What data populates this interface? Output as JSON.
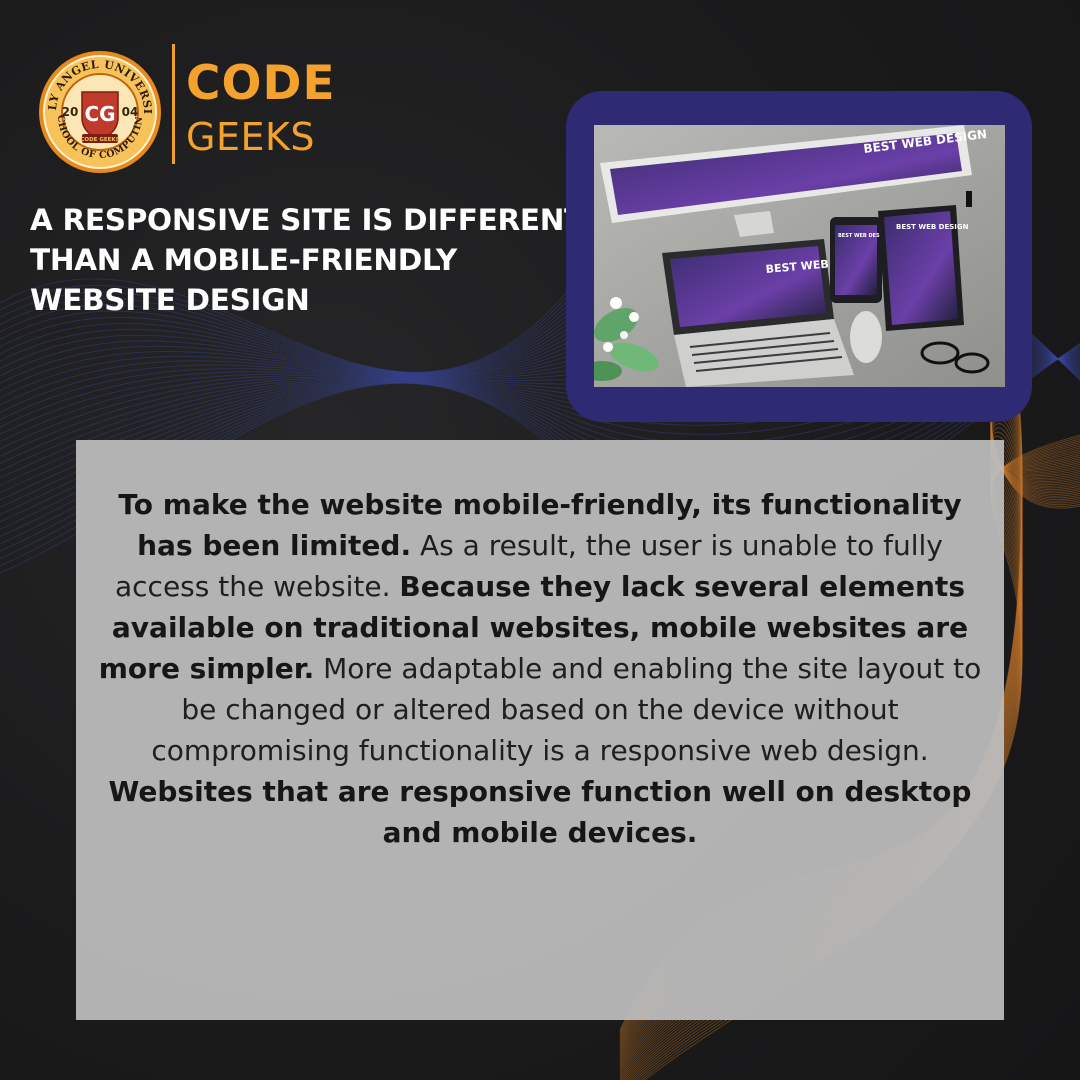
{
  "brand": {
    "seal_top_text": "HOLY ANGEL UNIVERSITY",
    "seal_bottom_text": "SCHOOL OF COMPUTING",
    "seal_year_left": "20",
    "seal_year_right": "04",
    "seal_monogram": "CG",
    "seal_ribbon": "CODE GEEKS",
    "name_line1": "CODE",
    "name_line2": "GEEKS"
  },
  "headline": "A RESPONSIVE SITE IS DIFFERENT THAN A MOBILE-FRIENDLY WEBSITE DESIGN",
  "photo": {
    "monitor_text": "BEST WEB DESIGN",
    "laptop_text": "BEST WEB DESIGN",
    "tablet_text": "BEST WEB DESIGN",
    "phone_text": "BEST WEB DESIGN"
  },
  "body": {
    "p1": "To make the website mobile-friendly, its functionality has been limited.",
    "p2": " As a result, the user is unable to fully access the website. ",
    "p3": "Because they lack several elements available on traditional websites, mobile websites are more simpler.",
    "p4": " More adaptable and enabling the site layout to be changed or altered based on the device without compromising functionality is a responsive web design. ",
    "p5": "Websites that are responsive function well on desktop and mobile devices."
  },
  "colors": {
    "background": "#1b1b1c",
    "accent_orange": "#f4a22d",
    "frame_navy": "#2e2a74",
    "panel_gray": "#bebebe",
    "wave_blue": "#3b4aa8",
    "wave_orange": "#c9782a"
  }
}
